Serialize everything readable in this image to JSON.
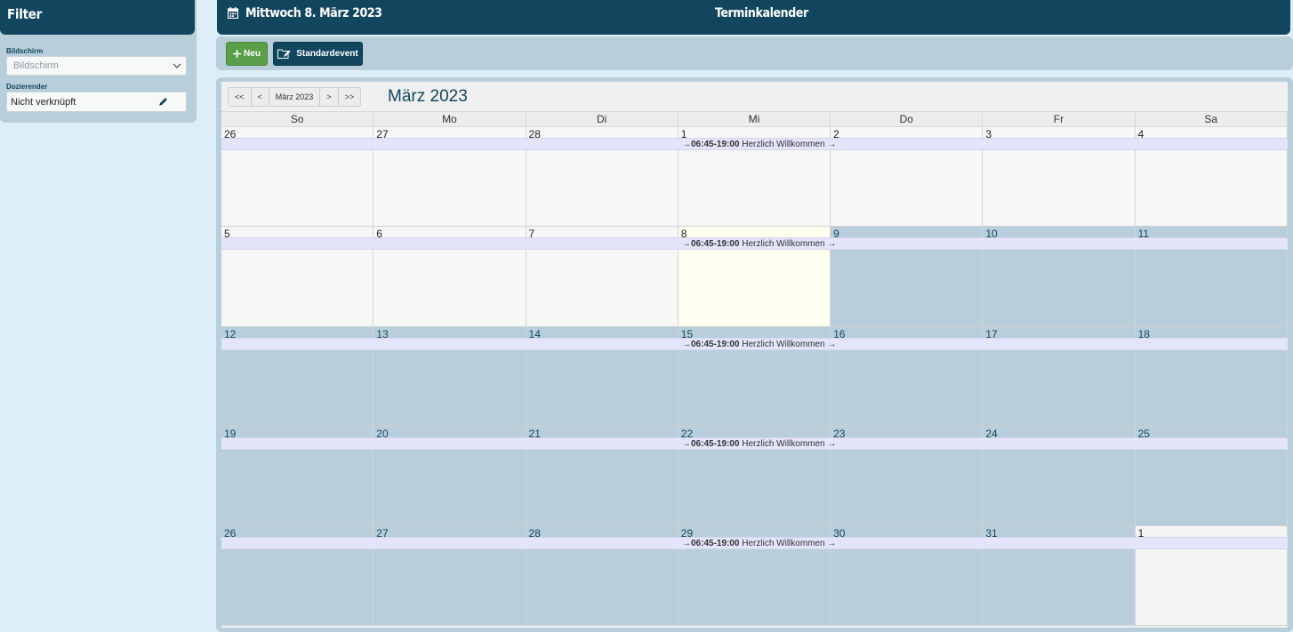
{
  "sidebar": {
    "title": "Filter",
    "screen_label": "Bildschirm",
    "screen_value": "Bildschirm",
    "lecturer_label": "Dozierender",
    "lecturer_value": "Nicht verknüpft"
  },
  "header": {
    "date": "Mittwoch 8. März 2023",
    "title": "Terminkalender"
  },
  "toolbar": {
    "new_label": "Neu",
    "standard_label": "Standardevent"
  },
  "calendar": {
    "nav": [
      "<<",
      "<",
      "März 2023",
      ">",
      ">>"
    ],
    "month_title": "März 2023",
    "weekdays": [
      "So",
      "Mo",
      "Di",
      "Mi",
      "Do",
      "Fr",
      "Sa"
    ],
    "weeks": [
      [
        "26",
        "27",
        "28",
        "1",
        "2",
        "3",
        "4"
      ],
      [
        "5",
        "6",
        "7",
        "8",
        "9",
        "10",
        "11"
      ],
      [
        "12",
        "13",
        "14",
        "15",
        "16",
        "17",
        "18"
      ],
      [
        "19",
        "20",
        "21",
        "22",
        "23",
        "24",
        "25"
      ],
      [
        "26",
        "27",
        "28",
        "29",
        "30",
        "31",
        "1"
      ]
    ],
    "event": {
      "time": "06:45-19:00",
      "title": "Herzlich Willkommen",
      "arrow_left": "→",
      "arrow_right": "→"
    }
  },
  "colors": {
    "header": "#12465f",
    "accent_new": "#5a9e4a",
    "future_day": "#b8cfdb",
    "today": "#fffff0"
  }
}
